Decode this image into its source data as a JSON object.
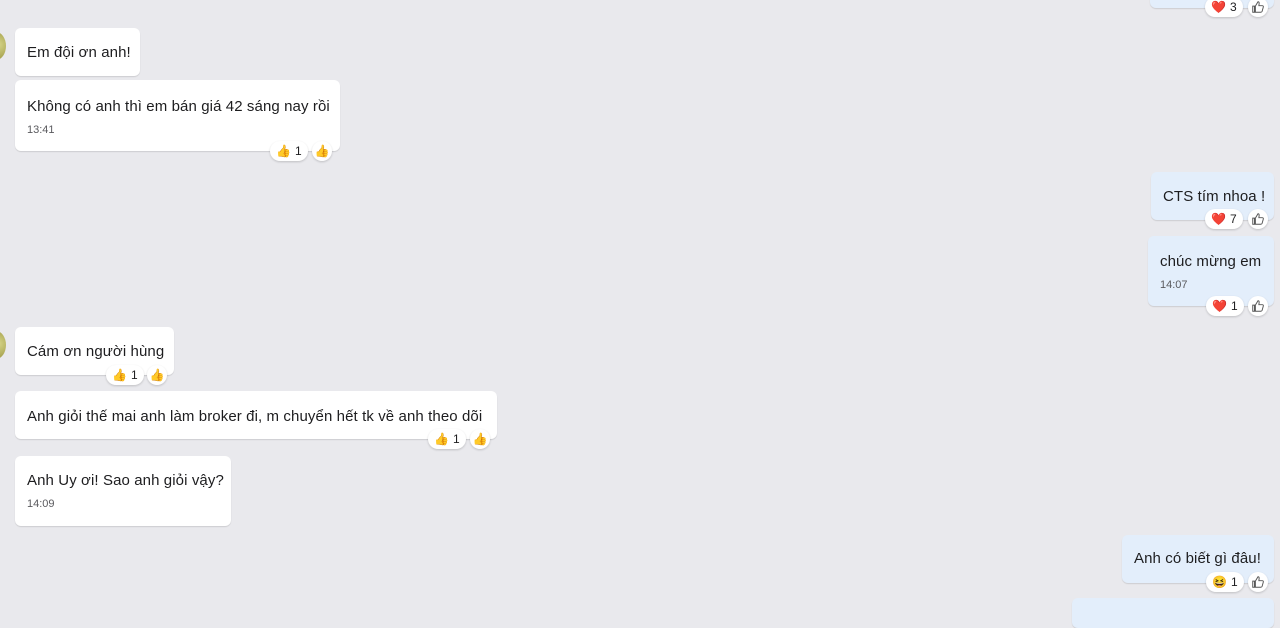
{
  "messages": [
    {
      "id": "m0",
      "side": "right",
      "text": "",
      "time": "",
      "reaction_emoji": "heart",
      "reaction_count": "3"
    },
    {
      "id": "m1",
      "side": "left",
      "text": "Em đội ơn anh!",
      "time": ""
    },
    {
      "id": "m2",
      "side": "left",
      "text": "Không có anh thì em bán giá 42 sáng nay rồi",
      "time": "13:41",
      "reaction_emoji": "thumbs-up",
      "reaction_count": "1"
    },
    {
      "id": "m3",
      "side": "right",
      "text": "CTS tím nhoa !",
      "time": "",
      "reaction_emoji": "heart",
      "reaction_count": "7"
    },
    {
      "id": "m4",
      "side": "right",
      "text": "chúc mừng em",
      "time": "14:07",
      "reaction_emoji": "heart",
      "reaction_count": "1"
    },
    {
      "id": "m5",
      "side": "left",
      "text": "Cám ơn người hùng",
      "time": "",
      "reaction_emoji": "thumbs-up",
      "reaction_count": "1"
    },
    {
      "id": "m6",
      "side": "left",
      "text": "Anh giỏi thế mai anh làm broker đi, m chuyển hết tk về anh theo dõi",
      "time": "",
      "reaction_emoji": "thumbs-up",
      "reaction_count": "1"
    },
    {
      "id": "m7",
      "side": "left",
      "text": "Anh Uy ơi! Sao anh giỏi vậy?",
      "time": "14:09"
    },
    {
      "id": "m8",
      "side": "right",
      "text": "Anh có biết gì đâu!",
      "time": "",
      "reaction_emoji": "laughing",
      "reaction_count": "1"
    }
  ],
  "emoji_glyphs": {
    "heart": "❤️",
    "thumbs-up": "👍",
    "laughing": "😆"
  },
  "colors": {
    "background": "#e9e9ed",
    "incoming_bubble": "#ffffff",
    "outgoing_bubble": "#e3eefb"
  }
}
